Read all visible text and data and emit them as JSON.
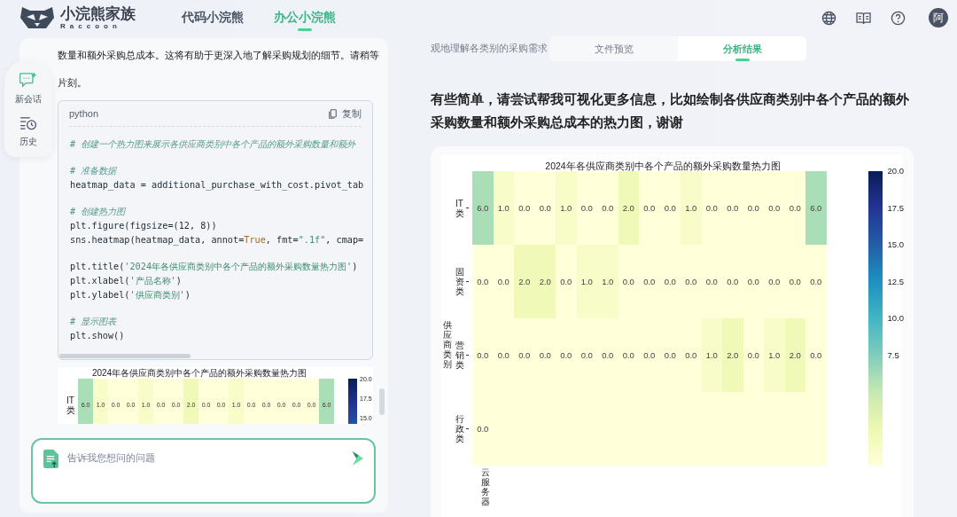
{
  "header": {
    "brand": "小浣熊家族",
    "brand_sub": "Raccoon",
    "avatar": "阿",
    "tabs": [
      {
        "label": "代码小浣熊",
        "selected": false
      },
      {
        "label": "办公小浣熊",
        "selected": true
      }
    ]
  },
  "sidebar": {
    "items": [
      {
        "label": "新会话",
        "kind": "new"
      },
      {
        "label": "历史",
        "kind": "history"
      }
    ]
  },
  "chat": {
    "message_lines": [
      "数量和额外采购总成本。这将有助于更深入地了解采购规划的细节。请稍等",
      "片刻。"
    ],
    "code": {
      "language": "python",
      "copy_label": "复制",
      "lines": [
        {
          "tokens": [
            {
              "kind": "comment",
              "text": "# 创建一个热力图来展示各供应商类别中各个产品的额外采购数量和额外"
            }
          ]
        },
        {
          "kind": "blank"
        },
        {
          "tokens": [
            {
              "kind": "comment",
              "text": "# 准备数据"
            }
          ]
        },
        {
          "tokens": [
            {
              "kind": "code",
              "text": "heatmap_data = additional_purchase_with_cost.pivot_tab"
            }
          ]
        },
        {
          "kind": "blank"
        },
        {
          "tokens": [
            {
              "kind": "comment",
              "text": "# 创建热力图"
            }
          ]
        },
        {
          "tokens": [
            {
              "kind": "code",
              "text": "plt.figure(figsize=(12, 8))"
            }
          ]
        },
        {
          "tokens": [
            {
              "kind": "code",
              "text": "sns.heatmap(heatmap_data, annot="
            },
            {
              "kind": "keyword",
              "text": "True"
            },
            {
              "kind": "code",
              "text": ", fmt="
            },
            {
              "kind": "string",
              "text": "\".1f\""
            },
            {
              "kind": "code",
              "text": ", cmap="
            }
          ]
        },
        {
          "kind": "blank"
        },
        {
          "tokens": [
            {
              "kind": "code",
              "text": "plt.title("
            },
            {
              "kind": "string",
              "text": "'2024年各供应商类别中各个产品的额外采购数量热力图'"
            },
            {
              "kind": "code",
              "text": ")"
            }
          ]
        },
        {
          "tokens": [
            {
              "kind": "code",
              "text": "plt.xlabel("
            },
            {
              "kind": "string",
              "text": "'产品名称'"
            },
            {
              "kind": "code",
              "text": ")"
            }
          ]
        },
        {
          "tokens": [
            {
              "kind": "code",
              "text": "plt.ylabel("
            },
            {
              "kind": "string",
              "text": "'供应商类别'"
            },
            {
              "kind": "code",
              "text": ")"
            }
          ]
        },
        {
          "kind": "blank"
        },
        {
          "tokens": [
            {
              "kind": "comment",
              "text": "# 显示图表"
            }
          ]
        },
        {
          "tokens": [
            {
              "kind": "code",
              "text": "plt.show()"
            }
          ]
        }
      ]
    },
    "thumbnail": {
      "title": "2024年各供应商类别中各个产品的额外采购数量热力图",
      "rows": [
        {
          "label": "IT类",
          "values": [
            "6.0",
            "1.0",
            "0.0",
            "0.0",
            "1.0",
            "0.0",
            "0.0",
            "2.0",
            "0.0",
            "0.0",
            "1.0",
            "0.0",
            "0.0",
            "0.0",
            "0.0",
            "0.0",
            "6.0"
          ]
        }
      ],
      "colorbar_ticks": [
        "20.0",
        "17.5",
        "15.0"
      ]
    },
    "input": {
      "placeholder": "告诉我您想问的问题"
    }
  },
  "result": {
    "context_text": "观地理解各类别的采购需求",
    "tabs": [
      {
        "label": "文件预览",
        "selected": false
      },
      {
        "label": "分析结果",
        "selected": true
      }
    ],
    "question": "有些简单，请尝试帮我可视化更多信息，比如绘制各供应商类别中各个产品的额外采购数量和额外采购总成本的热力图，谢谢",
    "heatmap": {
      "title": "2024年各供应商类别中各个产品的额外采购数量热力图",
      "ylabel": "供应商类别",
      "rows": [
        {
          "label": "IT类",
          "values": [
            "6.0",
            "1.0",
            "0.0",
            "0.0",
            "1.0",
            "0.0",
            "0.0",
            "2.0",
            "0.0",
            "0.0",
            "1.0",
            "0.0",
            "0.0",
            "0.0",
            "0.0",
            "0.0",
            "6.0"
          ]
        },
        {
          "label": "固资类",
          "values": [
            "0.0",
            "0.0",
            "2.0",
            "2.0",
            "0.0",
            "1.0",
            "1.0",
            "0.0",
            "0.0",
            "0.0",
            "0.0",
            "0.0",
            "0.0",
            "0.0",
            "0.0",
            "0.0",
            "0.0"
          ]
        },
        {
          "label": "营销类",
          "values": [
            "0.0",
            "0.0",
            "0.0",
            "0.0",
            "0.0",
            "0.0",
            "0.0",
            "0.0",
            "0.0",
            "0.0",
            "0.0",
            "1.0",
            "2.0",
            "0.0",
            "1.0",
            "2.0",
            "0.0"
          ]
        },
        {
          "label": "行政类",
          "values": [
            "0.0"
          ]
        }
      ],
      "column_labels": [
        "云服务器"
      ],
      "colorbar_ticks": [
        "20.0",
        "17.5",
        "15.0",
        "12.5",
        "10.0",
        "7.5"
      ]
    }
  }
}
